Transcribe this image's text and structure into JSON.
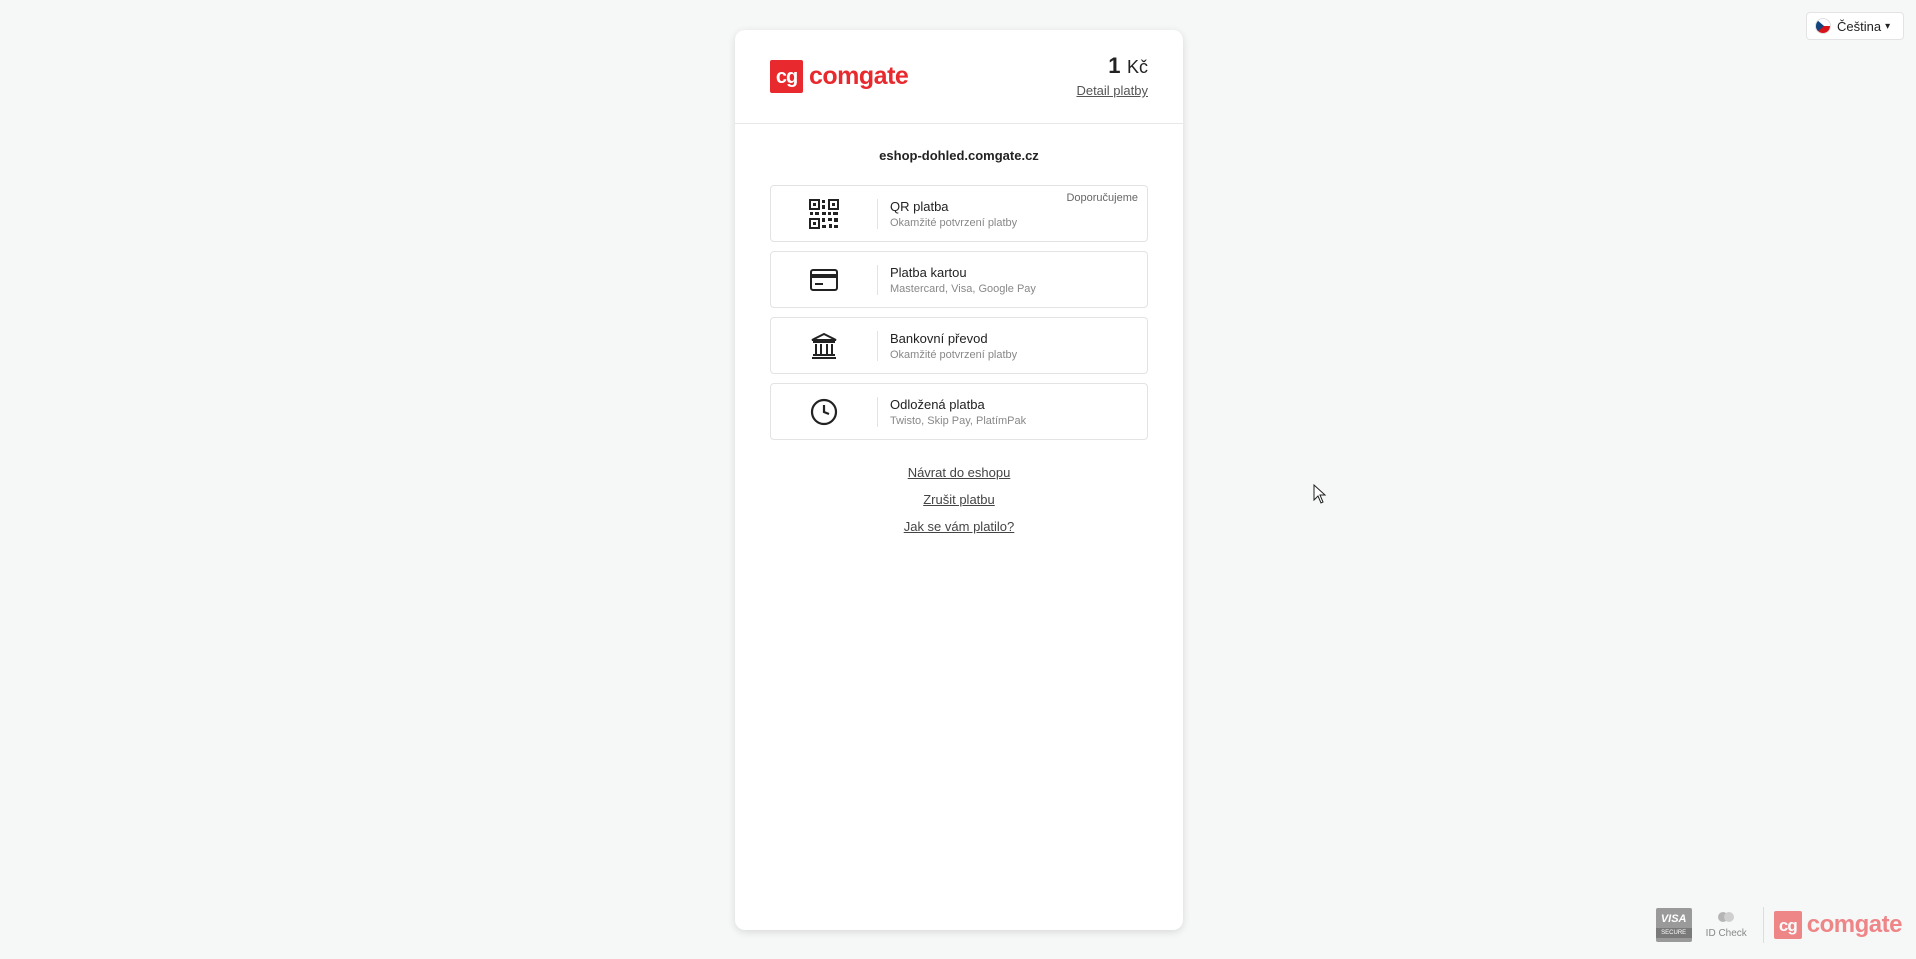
{
  "language": {
    "label": "Čeština"
  },
  "header": {
    "logo_mark": "cg",
    "logo_text": "comgate",
    "amount_value": "1",
    "amount_currency": "Kč",
    "detail_link": "Detail platby"
  },
  "merchant": "eshop-dohled.comgate.cz",
  "methods": [
    {
      "title": "QR platba",
      "subtitle": "Okamžité potvrzení platby",
      "badge": "Doporučujeme",
      "icon": "qr-code-icon"
    },
    {
      "title": "Platba kartou",
      "subtitle": "Mastercard, Visa, Google Pay",
      "icon": "credit-card-icon"
    },
    {
      "title": "Bankovní převod",
      "subtitle": "Okamžité potvrzení platby",
      "icon": "bank-icon"
    },
    {
      "title": "Odložená platba",
      "subtitle": "Twisto, Skip Pay, PlatímPak",
      "icon": "clock-icon"
    }
  ],
  "links": {
    "back_to_shop": "Návrat do eshopu",
    "cancel_payment": "Zrušit platbu",
    "feedback": "Jak se vám platilo?"
  },
  "footer": {
    "visa_text": "VISA",
    "visa_secure": "SECURE",
    "id_check": "ID Check",
    "logo_mark": "cg",
    "logo_text": "comgate"
  },
  "colors": {
    "brand": "#e8292d",
    "background": "#f6f7f7"
  }
}
